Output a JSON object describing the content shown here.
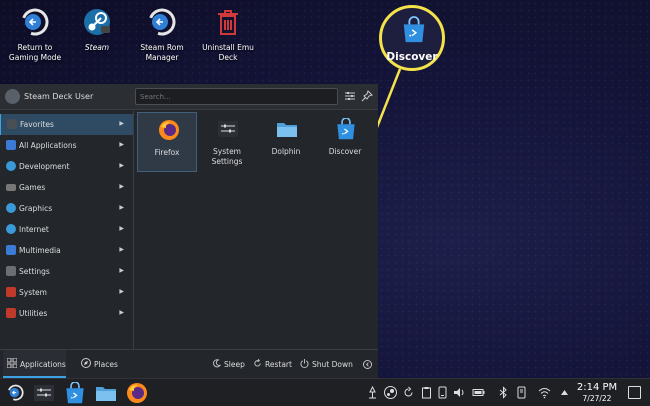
{
  "desktop": {
    "icons": [
      {
        "label": "Return to Gaming Mode",
        "icon": "return-icon"
      },
      {
        "label": "Steam",
        "icon": "steam-icon"
      },
      {
        "label": "Steam Rom Manager",
        "icon": "return-icon"
      },
      {
        "label": "Uninstall Emu Deck",
        "icon": "trash-icon"
      }
    ]
  },
  "callout": {
    "label": "Discover",
    "icon": "discover-bag-icon",
    "color": "#f3e24a"
  },
  "launcher": {
    "user": "Steam Deck User",
    "search_placeholder": "Search...",
    "categories": [
      {
        "label": "Favorites",
        "selected": true
      },
      {
        "label": "All Applications"
      },
      {
        "label": "Development"
      },
      {
        "label": "Games"
      },
      {
        "label": "Graphics"
      },
      {
        "label": "Internet"
      },
      {
        "label": "Multimedia"
      },
      {
        "label": "Settings"
      },
      {
        "label": "System"
      },
      {
        "label": "Utilities"
      }
    ],
    "apps": [
      {
        "label": "Firefox",
        "icon": "firefox-icon",
        "selected": true
      },
      {
        "label": "System Settings",
        "icon": "settings-icon"
      },
      {
        "label": "Dolphin",
        "icon": "folder-icon"
      },
      {
        "label": "Discover",
        "icon": "discover-bag-icon"
      }
    ],
    "footer": {
      "tabs": [
        {
          "label": "Applications"
        },
        {
          "label": "Places"
        }
      ],
      "actions": [
        {
          "label": "Sleep"
        },
        {
          "label": "Restart"
        },
        {
          "label": "Shut Down"
        }
      ]
    }
  },
  "taskbar": {
    "time": "2:14 PM",
    "date": "7/27/22"
  },
  "colors": {
    "accent": "#3da2e2",
    "callout": "#f3e24a"
  }
}
